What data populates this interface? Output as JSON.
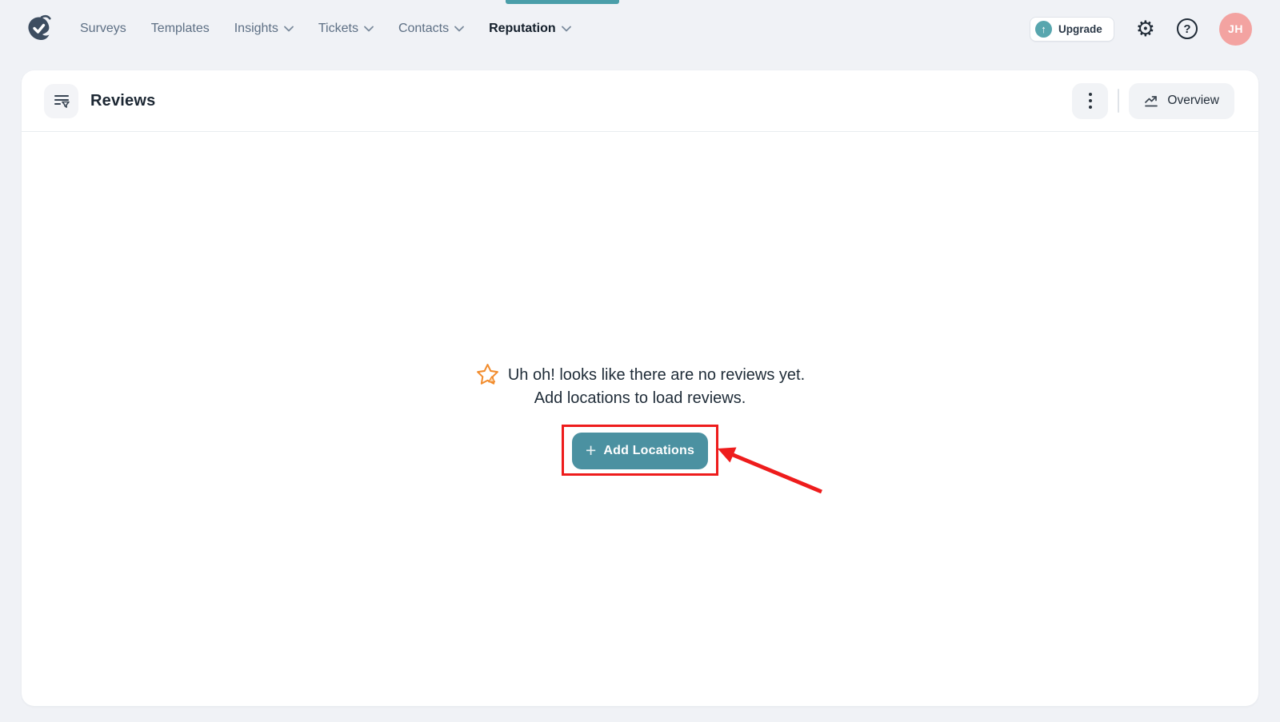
{
  "topnav": {
    "items": [
      {
        "label": "Surveys",
        "dropdown": false,
        "active": false
      },
      {
        "label": "Templates",
        "dropdown": false,
        "active": false
      },
      {
        "label": "Insights",
        "dropdown": true,
        "active": false
      },
      {
        "label": "Tickets",
        "dropdown": true,
        "active": false
      },
      {
        "label": "Contacts",
        "dropdown": true,
        "active": false
      },
      {
        "label": "Reputation",
        "dropdown": true,
        "active": true
      }
    ],
    "upgrade_label": "Upgrade",
    "avatar_initials": "JH",
    "glyphs": {
      "gear": "⚙",
      "help": "?",
      "upgrade_arrow": "↑"
    }
  },
  "header": {
    "title": "Reviews",
    "overview_label": "Overview",
    "icons": {
      "left": "filter-list-icon",
      "menu": "kebab-menu-icon",
      "overview": "trend-chart-icon"
    }
  },
  "empty_state": {
    "icon": "star-alert-icon",
    "line1": "Uh oh! looks like there are no reviews yet.",
    "line2": "Add locations to load reviews.",
    "button_plus": "+",
    "button_label": "Add Locations"
  },
  "colors": {
    "accent_teal": "#4b91a1",
    "active_tab_indicator": "#4a9ea9",
    "avatar_bg": "#f3a3a1",
    "page_bg": "#f0f2f6",
    "card_bg": "#ffffff",
    "nav_text": "#5d6f84",
    "nav_text_active": "#141f2b",
    "annotation_red": "#ee1c1c",
    "empty_star_orange": "#f28c2d"
  }
}
